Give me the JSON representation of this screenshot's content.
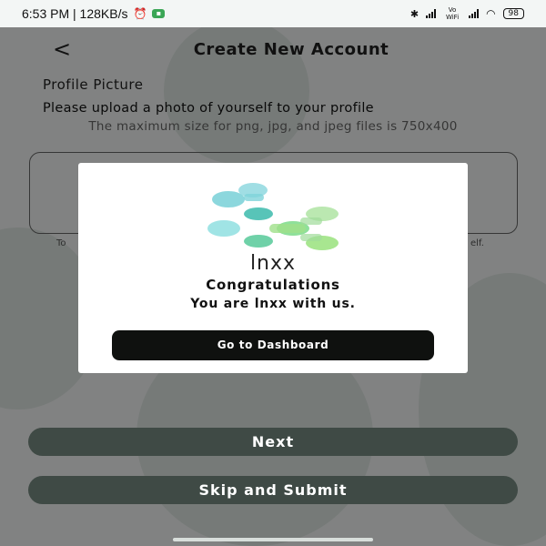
{
  "status_bar": {
    "time_speed": "6:53 PM | 128KB/s",
    "volte": "Vo WiFi",
    "battery": "98"
  },
  "header": {
    "back_symbol": "<",
    "title": "Create New Account"
  },
  "form": {
    "section_label": "Profile Picture",
    "instruction": "Please upload a photo of yourself to your profile",
    "size_note": "The maximum size for png, jpg, and jpeg files is 750x400",
    "hint_left": "To",
    "hint_right": "elf."
  },
  "buttons": {
    "next": "Next",
    "skip_submit": "Skip and Submit"
  },
  "modal": {
    "logo_text": "lnxx",
    "heading": "Congratulations",
    "message": "You are lnxx with us.",
    "dashboard_button": "Go to Dashboard"
  },
  "icons": {
    "back": "chevron-left-icon",
    "bluetooth": "bluetooth-icon",
    "wifi": "wifi-icon",
    "battery": "battery-icon"
  },
  "colors": {
    "logo_teal": "#7fd3d9",
    "logo_green": "#9fe08a",
    "logo_mid": "#58c4a8",
    "button_dark": "#0f110f"
  }
}
